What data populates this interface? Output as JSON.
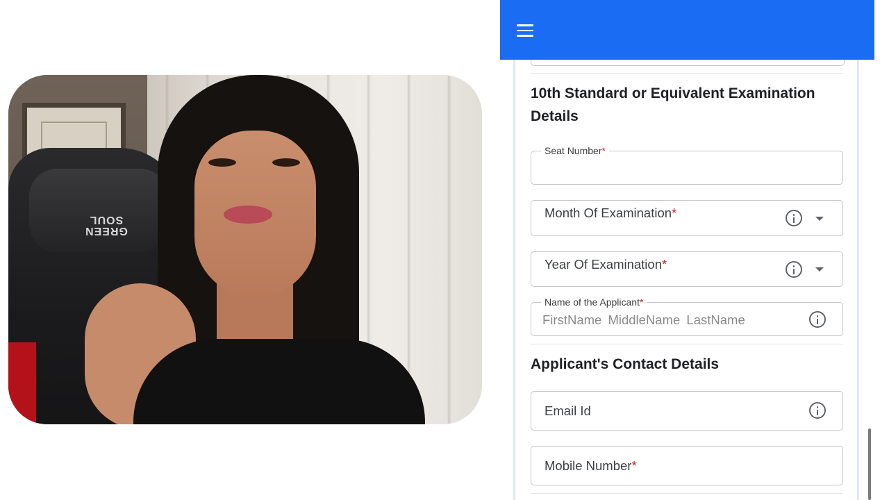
{
  "app": {
    "menu_icon": "hamburger-menu-icon",
    "accent_color": "#1a6cf2"
  },
  "section_10th": {
    "title_line1": "10th Standard or Equivalent Examination",
    "title_line2": "Details"
  },
  "fields": {
    "seat_number": {
      "label": "Seat Number",
      "required": "*",
      "value": ""
    },
    "month_of_examination": {
      "label": "Month Of Examination",
      "required": "*",
      "value": ""
    },
    "year_of_examination": {
      "label": "Year Of Examination",
      "required": "*",
      "value": ""
    },
    "applicant_name": {
      "label": "Name of the Applicant",
      "required": "*",
      "placeholder": "FirstName MiddleName LastName"
    }
  },
  "section_contact": {
    "title": "Applicant's Contact Details"
  },
  "contact_fields": {
    "email": {
      "label": "Email Id",
      "value": ""
    },
    "mobile": {
      "label": "Mobile Number",
      "required": "*",
      "value": ""
    }
  },
  "video": {
    "chair_logo_line1": "GREEN",
    "chair_logo_line2": "SOUL"
  }
}
